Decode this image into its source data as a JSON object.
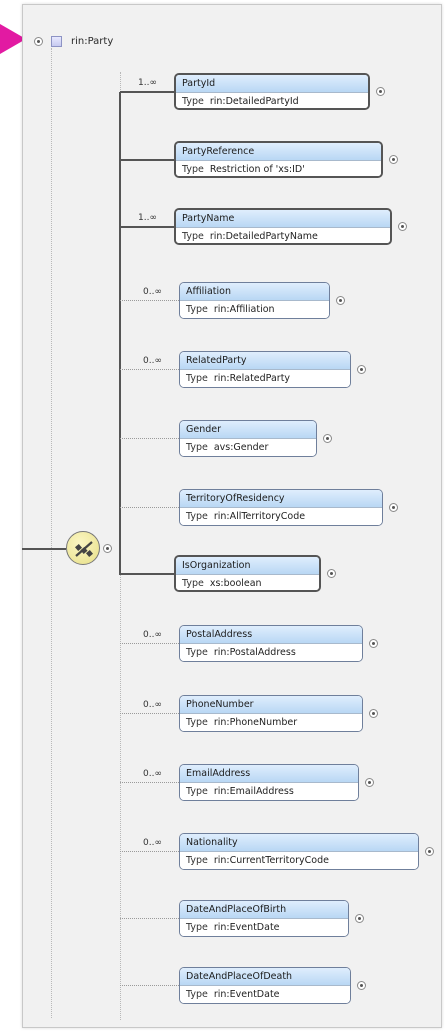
{
  "root": {
    "label": "rin:Party"
  },
  "type_keyword": "Type",
  "nodes": [
    {
      "name": "PartyId",
      "type": "rin:DetailedPartyId",
      "card": "1..∞",
      "required": true
    },
    {
      "name": "PartyReference",
      "type": "Restriction of 'xs:ID'",
      "card": "",
      "required": true
    },
    {
      "name": "PartyName",
      "type": "rin:DetailedPartyName",
      "card": "1..∞",
      "required": true
    },
    {
      "name": "Affiliation",
      "type": "rin:Affiliation",
      "card": "0..∞",
      "required": false
    },
    {
      "name": "RelatedParty",
      "type": "rin:RelatedParty",
      "card": "0..∞",
      "required": false
    },
    {
      "name": "Gender",
      "type": "avs:Gender",
      "card": "",
      "required": false
    },
    {
      "name": "TerritoryOfResidency",
      "type": "rin:AllTerritoryCode",
      "card": "",
      "required": false
    },
    {
      "name": "IsOrganization",
      "type": "xs:boolean",
      "card": "",
      "required": true
    },
    {
      "name": "PostalAddress",
      "type": "rin:PostalAddress",
      "card": "0..∞",
      "required": false
    },
    {
      "name": "PhoneNumber",
      "type": "rin:PhoneNumber",
      "card": "0..∞",
      "required": false
    },
    {
      "name": "EmailAddress",
      "type": "rin:EmailAddress",
      "card": "0..∞",
      "required": false
    },
    {
      "name": "Nationality",
      "type": "rin:CurrentTerritoryCode",
      "card": "0..∞",
      "required": false
    },
    {
      "name": "DateAndPlaceOfBirth",
      "type": "rin:EventDate",
      "card": "",
      "required": false
    },
    {
      "name": "DateAndPlaceOfDeath",
      "type": "rin:EventDate",
      "card": "",
      "required": false
    }
  ],
  "colors": {
    "pointer": "#e21aa2",
    "node_header": "#c6def6",
    "sequence_icon": "#ece49a"
  },
  "icons": {
    "root": "element-icon",
    "sequence": "sequence-compositor-icon",
    "expand": "circle-expand-icon"
  }
}
